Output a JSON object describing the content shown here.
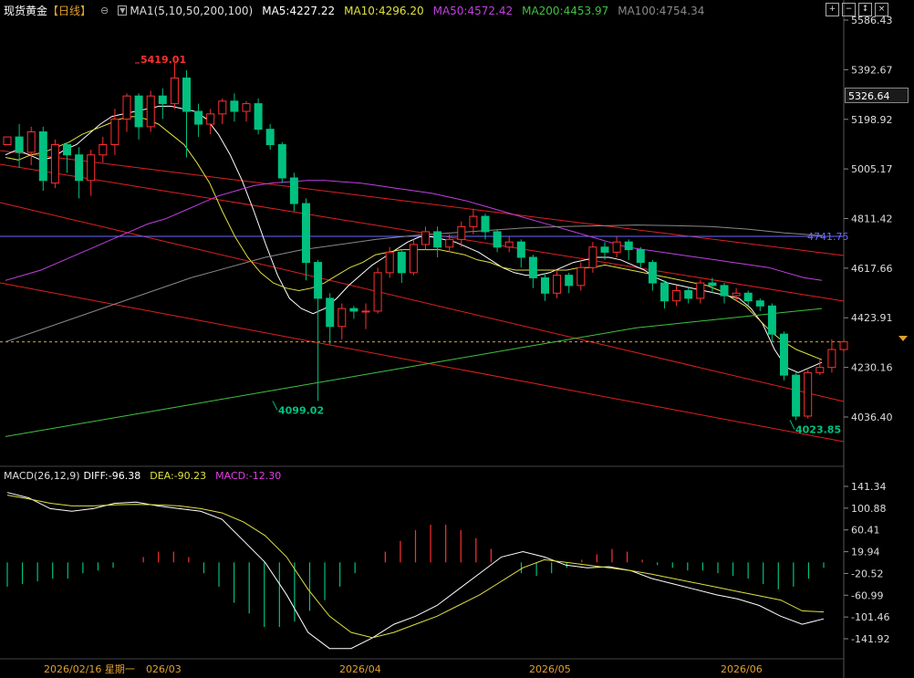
{
  "header": {
    "symbol": "现货黄金",
    "period": "【日线】",
    "ma_title": "MA1(5,10,50,200,100)",
    "ma5": "MA5:4227.22",
    "ma10": "MA10:4296.20",
    "ma50": "MA50:4572.42",
    "ma200": "MA200:4453.97",
    "ma100": "MA100:4754.34"
  },
  "macd_header": {
    "title": "MACD(26,12,9)",
    "diff": "DIFF:-96.38",
    "dea": "DEA:-90.23",
    "macd": "MACD:-12.30"
  },
  "current_price_label": "5326.64",
  "hline_label": "4741.75",
  "toolbar": [
    "+",
    "−",
    "↕",
    "×"
  ],
  "colors": {
    "up": "#ff3030",
    "down": "#00c080",
    "ma5": "#ffffff",
    "ma10": "#e0e040",
    "ma50": "#c040e0",
    "ma200": "#40c040",
    "ma100": "#888888",
    "hline": "#6a6aff",
    "channel": "#e02020"
  },
  "chart_data": {
    "type": "candlestick",
    "price_ylim": [
      3960,
      5640
    ],
    "price_ticks": [
      "5586.43",
      "5392.67",
      "5198.92",
      "5005.17",
      "4811.42",
      "4617.66",
      "4423.91",
      "4230.16",
      "4036.40"
    ],
    "macd_ticks": [
      "141.34",
      "100.88",
      "60.41",
      "19.94",
      "-20.52",
      "-60.99",
      "-101.46",
      "-141.92"
    ],
    "x_labels": [
      "2026/02/16 星期一",
      "026/03",
      "2026/04",
      "2026/05",
      "2026/06"
    ],
    "annotations": [
      {
        "text": "5419.01",
        "value": 5419.01
      },
      {
        "text": "4099.02",
        "value": 4099.02
      },
      {
        "text": "4023.85",
        "value": 4023.85
      }
    ],
    "horizontal_line": 4741.75,
    "current_price": 4330,
    "candles": [
      [
        5100,
        5130,
        5040,
        5000,
        5150
      ],
      [
        5130,
        5070,
        5040,
        5180,
        5010
      ],
      [
        5070,
        5150,
        5050,
        5170,
        5020
      ],
      [
        5150,
        4960,
        4930,
        5170,
        4920
      ],
      [
        4950,
        5100,
        4940,
        5120,
        4930
      ],
      [
        5100,
        5060,
        5040,
        5110,
        4990
      ],
      [
        5060,
        4960,
        4920,
        5090,
        4890
      ],
      [
        4960,
        5060,
        4950,
        5080,
        4900
      ],
      [
        5060,
        5100,
        5050,
        5130,
        5030
      ],
      [
        5100,
        5200,
        5090,
        5240,
        5060
      ],
      [
        5200,
        5290,
        5180,
        5300,
        5150
      ],
      [
        5290,
        5170,
        5150,
        5300,
        5120
      ],
      [
        5170,
        5290,
        5160,
        5310,
        5150
      ],
      [
        5290,
        5260,
        5230,
        5320,
        5200
      ],
      [
        5260,
        5360,
        5250,
        5419.01,
        5240
      ],
      [
        5360,
        5230,
        5200,
        5390,
        5050
      ],
      [
        5230,
        5180,
        5160,
        5260,
        5130
      ],
      [
        5180,
        5220,
        5150,
        5240,
        5140
      ],
      [
        5220,
        5270,
        5200,
        5280,
        5180
      ],
      [
        5270,
        5230,
        5200,
        5300,
        5190
      ],
      [
        5230,
        5260,
        5210,
        5270,
        5190
      ],
      [
        5260,
        5160,
        5150,
        5280,
        5140
      ],
      [
        5160,
        5100,
        5080,
        5180,
        5080
      ],
      [
        5100,
        4970,
        4960,
        5110,
        4950
      ],
      [
        4970,
        4870,
        4850,
        4990,
        4840
      ],
      [
        4870,
        4640,
        4600,
        4890,
        4570
      ],
      [
        4640,
        4500,
        4470,
        4650,
        4099.02
      ],
      [
        4500,
        4390,
        4350,
        4520,
        4320
      ],
      [
        4390,
        4460,
        4380,
        4480,
        4340
      ],
      [
        4460,
        4450,
        4440,
        4470,
        4420
      ],
      [
        4450,
        4450,
        4440,
        4480,
        4380
      ],
      [
        4450,
        4600,
        4440,
        4620,
        4440
      ],
      [
        4600,
        4680,
        4590,
        4700,
        4580
      ],
      [
        4680,
        4600,
        4580,
        4690,
        4560
      ],
      [
        4600,
        4710,
        4590,
        4730,
        4590
      ],
      [
        4710,
        4760,
        4700,
        4780,
        4690
      ],
      [
        4760,
        4700,
        4680,
        4780,
        4660
      ],
      [
        4700,
        4730,
        4690,
        4750,
        4680
      ],
      [
        4730,
        4780,
        4720,
        4800,
        4700
      ],
      [
        4780,
        4820,
        4770,
        4850,
        4750
      ],
      [
        4820,
        4760,
        4740,
        4830,
        4730
      ],
      [
        4760,
        4700,
        4690,
        4770,
        4680
      ],
      [
        4700,
        4720,
        4690,
        4740,
        4680
      ],
      [
        4720,
        4660,
        4650,
        4730,
        4620
      ],
      [
        4660,
        4580,
        4570,
        4670,
        4540
      ],
      [
        4580,
        4520,
        4500,
        4600,
        4490
      ],
      [
        4520,
        4590,
        4510,
        4610,
        4500
      ],
      [
        4590,
        4550,
        4540,
        4600,
        4520
      ],
      [
        4550,
        4620,
        4540,
        4640,
        4530
      ],
      [
        4620,
        4700,
        4610,
        4720,
        4600
      ],
      [
        4700,
        4680,
        4660,
        4720,
        4650
      ],
      [
        4680,
        4720,
        4670,
        4740,
        4660
      ],
      [
        4720,
        4690,
        4670,
        4730,
        4650
      ],
      [
        4690,
        4640,
        4620,
        4700,
        4620
      ],
      [
        4640,
        4560,
        4540,
        4650,
        4530
      ],
      [
        4560,
        4490,
        4470,
        4570,
        4460
      ],
      [
        4490,
        4530,
        4480,
        4550,
        4470
      ],
      [
        4530,
        4500,
        4490,
        4540,
        4480
      ],
      [
        4500,
        4560,
        4490,
        4570,
        4480
      ],
      [
        4560,
        4550,
        4530,
        4580,
        4520
      ],
      [
        4550,
        4510,
        4490,
        4560,
        4480
      ],
      [
        4510,
        4520,
        4500,
        4540,
        4490
      ],
      [
        4520,
        4490,
        4480,
        4530,
        4470
      ],
      [
        4490,
        4470,
        4460,
        4500,
        4450
      ],
      [
        4470,
        4360,
        4340,
        4480,
        4330
      ],
      [
        4360,
        4200,
        4190,
        4370,
        4180
      ],
      [
        4200,
        4040,
        4030,
        4210,
        4023.85
      ],
      [
        4040,
        4210,
        4030,
        4220,
        4030
      ],
      [
        4210,
        4230,
        4200,
        4260,
        4200
      ],
      [
        4230,
        4300,
        4220,
        4340,
        4210
      ],
      [
        4300,
        4330,
        4290,
        4340,
        4290
      ]
    ],
    "series": [
      {
        "name": "MA5",
        "values": [
          5060,
          5080,
          5060,
          5040,
          5050,
          5080,
          5100,
          5140,
          5180,
          5210,
          5220,
          5230,
          5240,
          5250,
          5250,
          5240,
          5230,
          5200,
          5140,
          5060,
          4960,
          4840,
          4710,
          4590,
          4500,
          4460,
          4440,
          4460,
          4500,
          4550,
          4590,
          4630,
          4660,
          4690,
          4720,
          4740,
          4740,
          4730,
          4720,
          4700,
          4680,
          4650,
          4620,
          4600,
          4590,
          4590,
          4600,
          4620,
          4640,
          4650,
          4660,
          4660,
          4650,
          4630,
          4610,
          4580,
          4560,
          4550,
          4540,
          4530,
          4520,
          4510,
          4500,
          4460,
          4400,
          4300,
          4230,
          4210,
          4230,
          4250
        ]
      },
      {
        "name": "MA10",
        "values": [
          5050,
          5040,
          5060,
          5070,
          5090,
          5110,
          5140,
          5160,
          5180,
          5200,
          5210,
          5200,
          5180,
          5140,
          5100,
          5030,
          4950,
          4840,
          4740,
          4660,
          4600,
          4560,
          4540,
          4530,
          4540,
          4560,
          4590,
          4620,
          4640,
          4670,
          4680,
          4690,
          4690,
          4690,
          4690,
          4680,
          4670,
          4650,
          4640,
          4620,
          4610,
          4610,
          4610,
          4610,
          4610,
          4620,
          4620,
          4630,
          4620,
          4610,
          4600,
          4590,
          4580,
          4570,
          4560,
          4550,
          4530,
          4500,
          4470,
          4420,
          4370,
          4330,
          4300,
          4280,
          4260
        ]
      },
      {
        "name": "MA50",
        "values": [
          4570,
          4590,
          4610,
          4640,
          4670,
          4700,
          4730,
          4760,
          4790,
          4810,
          4840,
          4870,
          4900,
          4920,
          4940,
          4950,
          4955,
          4960,
          4960,
          4955,
          4950,
          4940,
          4930,
          4920,
          4910,
          4895,
          4880,
          4860,
          4840,
          4820,
          4800,
          4780,
          4760,
          4740,
          4720,
          4700,
          4690,
          4680,
          4670,
          4660,
          4650,
          4640,
          4630,
          4620,
          4600,
          4580,
          4570
        ]
      },
      {
        "name": "MA200",
        "values": [
          3960,
          3985,
          4010,
          4035,
          4060,
          4085,
          4110,
          4135,
          4160,
          4185,
          4210,
          4235,
          4260,
          4285,
          4310,
          4335,
          4360,
          4385,
          4400,
          4415,
          4430,
          4445,
          4460
        ]
      },
      {
        "name": "MA100",
        "values": [
          4330,
          4380,
          4430,
          4480,
          4530,
          4580,
          4620,
          4660,
          4690,
          4710,
          4730,
          4745,
          4755,
          4765,
          4775,
          4780,
          4783,
          4786,
          4784,
          4780,
          4770,
          4755,
          4745
        ]
      }
    ],
    "macd": {
      "diff": [
        130,
        120,
        100,
        95,
        100,
        110,
        112,
        105,
        100,
        95,
        80,
        40,
        0,
        -60,
        -130,
        -160,
        -160,
        -140,
        -115,
        -100,
        -80,
        -50,
        -20,
        10,
        20,
        10,
        -5,
        -10,
        -8,
        -15,
        -30,
        -40,
        -50,
        -60,
        -68,
        -80,
        -100,
        -115,
        -105
      ],
      "dea": [
        125,
        118,
        110,
        105,
        105,
        107,
        108,
        107,
        105,
        100,
        92,
        75,
        50,
        10,
        -50,
        -100,
        -130,
        -140,
        -130,
        -115,
        -100,
        -80,
        -60,
        -35,
        -10,
        5,
        0,
        -5,
        -10,
        -15,
        -22,
        -30,
        -38,
        -46,
        -54,
        -62,
        -70,
        -90,
        -92
      ],
      "histogram": [
        -45,
        -40,
        -35,
        -30,
        -30,
        -20,
        -15,
        -10,
        0,
        10,
        20,
        20,
        10,
        -20,
        -45,
        -75,
        -95,
        -120,
        -120,
        -110,
        -90,
        -70,
        -45,
        -20,
        0,
        20,
        40,
        60,
        70,
        70,
        60,
        45,
        25,
        0,
        -20,
        -25,
        -20,
        -10,
        5,
        15,
        25,
        20,
        5,
        -5,
        -10,
        -15,
        -15,
        -20,
        -25,
        -30,
        -40,
        -50,
        -45,
        -30,
        -10
      ]
    }
  }
}
